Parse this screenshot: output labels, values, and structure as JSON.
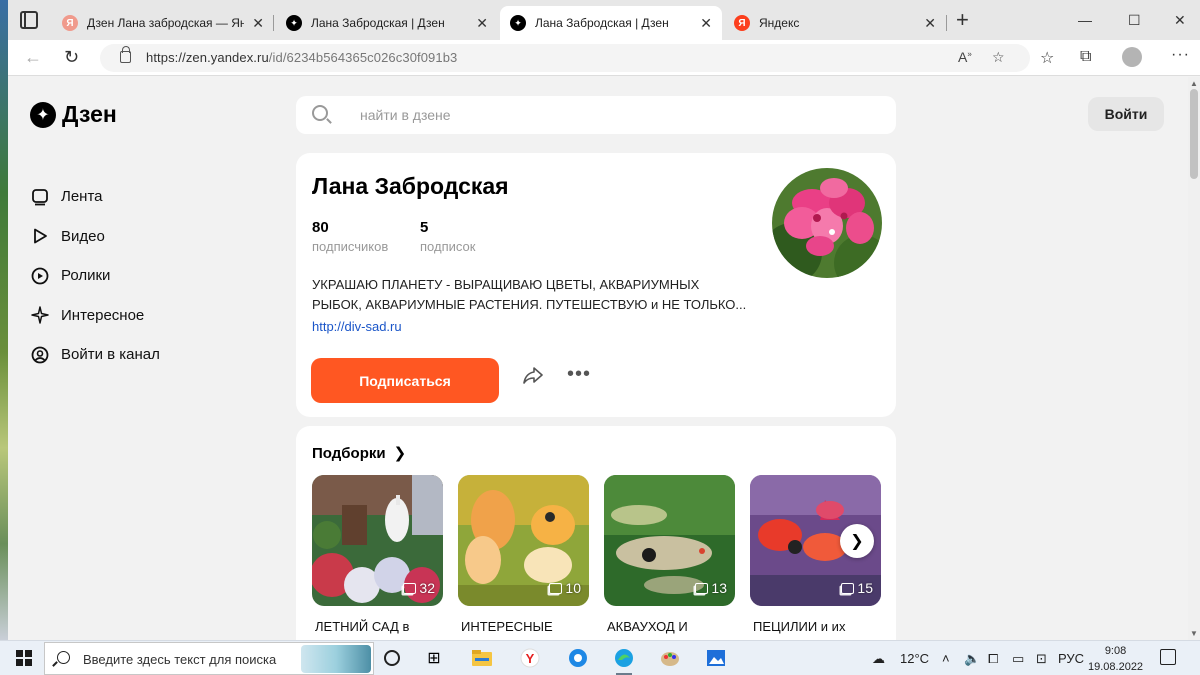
{
  "browser": {
    "tabs": [
      {
        "label": "Дзен Лана забродская — Яндекс",
        "favicon": "yandex",
        "active": false
      },
      {
        "label": "Лана Забродская | Дзен",
        "favicon": "zen",
        "active": false
      },
      {
        "label": "Лана Забродская | Дзен",
        "favicon": "zen",
        "active": true
      },
      {
        "label": "Яндекс",
        "favicon": "yandex",
        "active": false
      }
    ],
    "url_host": "https://zen.yandex.ru",
    "url_path": "/id/6234b564365c026c30f091b3"
  },
  "site": {
    "logo_text": "Дзен",
    "search_placeholder": "найти в дзене",
    "login_label": "Войти",
    "nav": [
      {
        "label": "Лента",
        "icon": "feed-icon"
      },
      {
        "label": "Видео",
        "icon": "play-icon"
      },
      {
        "label": "Ролики",
        "icon": "shorts-icon"
      },
      {
        "label": "Интересное",
        "icon": "sparkle-icon"
      },
      {
        "label": "Войти в канал",
        "icon": "user-icon"
      }
    ]
  },
  "channel": {
    "name": "Лана Забродская",
    "subscribers_count": "80",
    "subscribers_label": "подписчиков",
    "subscriptions_count": "5",
    "subscriptions_label": "подписок",
    "description": "УКРАШАЮ ПЛАНЕТУ - ВЫРАЩИВАЮ ЦВЕТЫ, АКВАРИУМНЫХ РЫБОК, АКВАРИУМНЫЕ РАСТЕНИЯ. ПУТЕШЕСТВУЮ и НЕ ТОЛЬКО...",
    "link": "http://div-sad.ru",
    "subscribe_label": "Подписаться",
    "accent_color": "#ff5722"
  },
  "collections": {
    "title": "Подборки",
    "items": [
      {
        "label": "ЛЕТНИЙ САД в",
        "count": "32"
      },
      {
        "label": "ИНТЕРЕСНЫЕ",
        "count": "10"
      },
      {
        "label": "АКВАУХОД И",
        "count": "13"
      },
      {
        "label": "ПЕЦИЛИИ и их",
        "count": "15"
      }
    ]
  },
  "taskbar": {
    "search_placeholder": "Введите здесь текст для поиска",
    "temperature": "12°C",
    "language": "РУС",
    "time": "9:08",
    "date": "19.08.2022"
  }
}
